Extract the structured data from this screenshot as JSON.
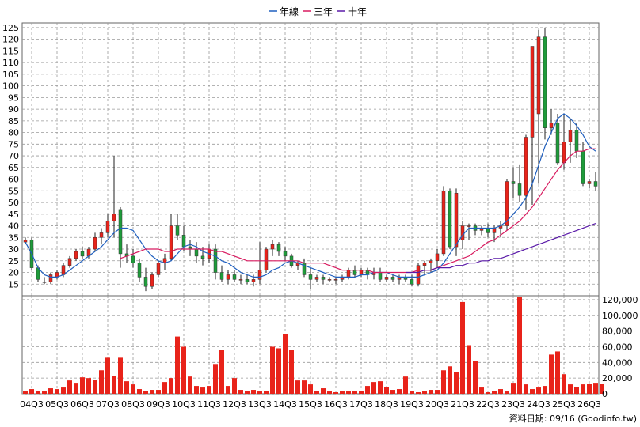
{
  "chart_data": [
    {
      "type": "candlestick",
      "legend": [
        {
          "label": "年線",
          "color": "#1f5fbf"
        },
        {
          "label": "三年",
          "color": "#d81b60"
        },
        {
          "label": "十年",
          "color": "#5a1aa8"
        }
      ],
      "colors": {
        "up": "#e8231a",
        "down": "#1e9c3a",
        "grid": "#9a9a9a"
      },
      "ylim": [
        10,
        127
      ],
      "yticks": [
        15,
        20,
        25,
        30,
        35,
        40,
        45,
        50,
        55,
        60,
        65,
        70,
        75,
        80,
        85,
        90,
        95,
        100,
        105,
        110,
        115,
        120,
        125
      ],
      "quarters": [
        "04Q3",
        "05Q3",
        "06Q3",
        "07Q3",
        "08Q3",
        "09Q3",
        "10Q3",
        "11Q3",
        "12Q3",
        "13Q3",
        "14Q3",
        "15Q3",
        "16Q3",
        "17Q3",
        "18Q3",
        "19Q3",
        "20Q3",
        "21Q3",
        "22Q3",
        "23Q3",
        "24Q3",
        "25Q3",
        "26Q3"
      ],
      "ohlc": [
        [
          33,
          35,
          32,
          34
        ],
        [
          34,
          35,
          21,
          22
        ],
        [
          22,
          23,
          16,
          17
        ],
        [
          16,
          18,
          15,
          16
        ],
        [
          16,
          20,
          15,
          19
        ],
        [
          18,
          21,
          17,
          20
        ],
        [
          19,
          24,
          18,
          23
        ],
        [
          23,
          27,
          22,
          26
        ],
        [
          26,
          30,
          25,
          29
        ],
        [
          29,
          31,
          26,
          27
        ],
        [
          27,
          31,
          26,
          30
        ],
        [
          30,
          37,
          29,
          35
        ],
        [
          35,
          39,
          32,
          37
        ],
        [
          37,
          45,
          35,
          42
        ],
        [
          42,
          70,
          35,
          45
        ],
        [
          47,
          48,
          22,
          28
        ],
        [
          28,
          32,
          24,
          27
        ],
        [
          27,
          30,
          22,
          24
        ],
        [
          24,
          26,
          16,
          18
        ],
        [
          18,
          22,
          12,
          14
        ],
        [
          14,
          20,
          13,
          19
        ],
        [
          19,
          25,
          18,
          24
        ],
        [
          24,
          28,
          21,
          26
        ],
        [
          26,
          45,
          25,
          40
        ],
        [
          40,
          45,
          34,
          36
        ],
        [
          36,
          40,
          29,
          31
        ],
        [
          31,
          34,
          27,
          30
        ],
        [
          30,
          33,
          24,
          27
        ],
        [
          27,
          31,
          23,
          26
        ],
        [
          26,
          32,
          24,
          30
        ],
        [
          30,
          32,
          17,
          20
        ],
        [
          20,
          23,
          16,
          17
        ],
        [
          17,
          21,
          15,
          19
        ],
        [
          19,
          21,
          16,
          17
        ],
        [
          17,
          19,
          15,
          17
        ],
        [
          17,
          19,
          15,
          16
        ],
        [
          16,
          19,
          14,
          17
        ],
        [
          17,
          33,
          15,
          21
        ],
        [
          21,
          31,
          20,
          30
        ],
        [
          30,
          34,
          27,
          32
        ],
        [
          32,
          33,
          27,
          29
        ],
        [
          29,
          31,
          25,
          27
        ],
        [
          27,
          28,
          22,
          23
        ],
        [
          23,
          25,
          21,
          24
        ],
        [
          24,
          26,
          18,
          19
        ],
        [
          19,
          22,
          13,
          17
        ],
        [
          17,
          19,
          16,
          18
        ],
        [
          18,
          19,
          15,
          17
        ],
        [
          17,
          18,
          16,
          17
        ],
        [
          17,
          18,
          15,
          17
        ],
        [
          17,
          19,
          16,
          18
        ],
        [
          18,
          22,
          17,
          21
        ],
        [
          21,
          23,
          18,
          19
        ],
        [
          19,
          22,
          18,
          21
        ],
        [
          21,
          22,
          17,
          19
        ],
        [
          19,
          22,
          17,
          20
        ],
        [
          20,
          22,
          16,
          17
        ],
        [
          17,
          19,
          16,
          18
        ],
        [
          18,
          19,
          16,
          17
        ],
        [
          17,
          19,
          15,
          18
        ],
        [
          18,
          19,
          16,
          17
        ],
        [
          17,
          19,
          14,
          15
        ],
        [
          15,
          24,
          14,
          23
        ],
        [
          23,
          25,
          19,
          24
        ],
        [
          24,
          26,
          20,
          25
        ],
        [
          25,
          30,
          22,
          28
        ],
        [
          28,
          57,
          27,
          55
        ],
        [
          55,
          56,
          30,
          31
        ],
        [
          31,
          56,
          27,
          54
        ],
        [
          34,
          42,
          30,
          40
        ],
        [
          40,
          41,
          34,
          40
        ],
        [
          40,
          41,
          36,
          38
        ],
        [
          38,
          40,
          36,
          39
        ],
        [
          39,
          41,
          35,
          37
        ],
        [
          37,
          40,
          33,
          39
        ],
        [
          39,
          42,
          35,
          40
        ],
        [
          40,
          60,
          38,
          59
        ],
        [
          59,
          65,
          52,
          58
        ],
        [
          58,
          66,
          50,
          53
        ],
        [
          53,
          79,
          47,
          78
        ],
        [
          78,
          91,
          49,
          117
        ],
        [
          88,
          124,
          58,
          121
        ],
        [
          121,
          125,
          77,
          82
        ],
        [
          82,
          90,
          79,
          84
        ],
        [
          84,
          88,
          66,
          67
        ],
        [
          67,
          88,
          64,
          76
        ],
        [
          76,
          86,
          67,
          81
        ],
        [
          81,
          84,
          69,
          72
        ],
        [
          72,
          76,
          57,
          58
        ],
        [
          58,
          60,
          56,
          59
        ],
        [
          59,
          63,
          55,
          57
        ]
      ],
      "line_1y": [
        33,
        28,
        22,
        19,
        18,
        18,
        19,
        21,
        23,
        25,
        27,
        29,
        31,
        34,
        37,
        39,
        39,
        38,
        34,
        30,
        27,
        25,
        24,
        25,
        28,
        31,
        32,
        31,
        29,
        28,
        27,
        25,
        24,
        22,
        20,
        19,
        18,
        18,
        19,
        21,
        22,
        24,
        25,
        24,
        23,
        22,
        21,
        20,
        19,
        18,
        18,
        18,
        18,
        19,
        19,
        20,
        20,
        20,
        19,
        18,
        18,
        18,
        18,
        19,
        20,
        21,
        24,
        28,
        32,
        36,
        39,
        39,
        39,
        39,
        39,
        40,
        42,
        45,
        48,
        52,
        58,
        66,
        74,
        80,
        86,
        88,
        86,
        83,
        79,
        74,
        72
      ],
      "line_3y": [
        null,
        null,
        null,
        null,
        null,
        null,
        null,
        null,
        null,
        null,
        null,
        null,
        null,
        null,
        null,
        26,
        27,
        28,
        29,
        30,
        30,
        30,
        29,
        29,
        30,
        30,
        30,
        30,
        30,
        30,
        29,
        29,
        28,
        27,
        26,
        25,
        25,
        25,
        25,
        25,
        25,
        25,
        25,
        25,
        24,
        24,
        24,
        24,
        23,
        22,
        21,
        21,
        21,
        21,
        21,
        20,
        20,
        20,
        20,
        20,
        20,
        20,
        21,
        21,
        21,
        22,
        23,
        24,
        25,
        26,
        27,
        29,
        31,
        33,
        34,
        36,
        38,
        40,
        42,
        45,
        48,
        52,
        56,
        60,
        64,
        67,
        70,
        72,
        72,
        73,
        73
      ],
      "line_10y": [
        null,
        null,
        null,
        null,
        null,
        null,
        null,
        null,
        null,
        null,
        null,
        null,
        null,
        null,
        null,
        null,
        null,
        null,
        null,
        null,
        null,
        null,
        null,
        null,
        null,
        null,
        null,
        null,
        null,
        null,
        null,
        null,
        null,
        null,
        null,
        null,
        null,
        null,
        null,
        null,
        null,
        null,
        null,
        null,
        null,
        null,
        null,
        null,
        null,
        null,
        null,
        null,
        null,
        null,
        null,
        null,
        null,
        null,
        null,
        null,
        20,
        20,
        20,
        21,
        21,
        22,
        22,
        22,
        23,
        23,
        24,
        24,
        25,
        25,
        26,
        26,
        27,
        28,
        29,
        30,
        31,
        32,
        33,
        34,
        35,
        36,
        37,
        38,
        39,
        40,
        41
      ],
      "volume": {
        "ylim": [
          0,
          125000
        ],
        "yticks": [
          0,
          20000,
          40000,
          60000,
          80000,
          100000,
          120000
        ],
        "ytick_labels": [
          "0",
          "20,000",
          "40,000",
          "60,000",
          "80,000",
          "100,000",
          "120,000"
        ],
        "values": [
          3000,
          6000,
          4000,
          3000,
          7000,
          6000,
          8000,
          17000,
          14000,
          21000,
          20000,
          18000,
          30000,
          46000,
          23000,
          46000,
          16000,
          12000,
          6000,
          4000,
          5000,
          5000,
          15000,
          20000,
          73000,
          60000,
          22000,
          10000,
          8000,
          10000,
          38000,
          56000,
          10000,
          20000,
          5000,
          4000,
          5000,
          3000,
          4000,
          60000,
          58000,
          76000,
          56000,
          17000,
          17000,
          12000,
          4000,
          7000,
          3000,
          2000,
          3000,
          3000,
          3000,
          4000,
          10000,
          15000,
          16000,
          9000,
          5000,
          6000,
          22000,
          3000,
          2000,
          3000,
          5000,
          5000,
          30000,
          35000,
          28000,
          117000,
          62000,
          42000,
          8000,
          2000,
          4000,
          6000,
          3000,
          14000,
          124000,
          12000,
          6000,
          8000,
          10000,
          50000,
          54000,
          25000,
          12000,
          9000,
          12000,
          13000,
          14000,
          13000
        ]
      },
      "credit": "資料日期: 09/16  (Goodinfo.tw)"
    }
  ]
}
